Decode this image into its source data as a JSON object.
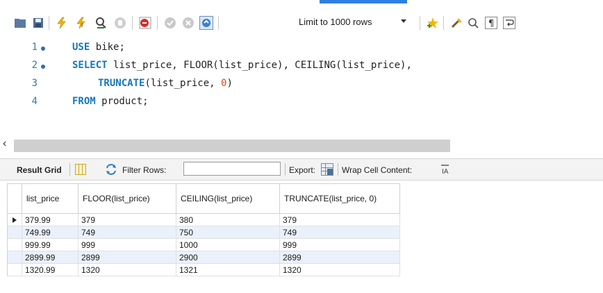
{
  "toolbar": {
    "limit_label": "Limit to 1000 rows"
  },
  "editor": {
    "lines": [
      {
        "num": "1",
        "has_dot": true
      },
      {
        "num": "2",
        "has_dot": true
      },
      {
        "num": "3",
        "has_dot": false
      },
      {
        "num": "4",
        "has_dot": false
      }
    ],
    "code": {
      "l1_kw": "USE",
      "l1_rest": " bike;",
      "l2_kw": "SELECT",
      "l2_rest": " list_price, FLOOR(list_price), CEILING(list_price),",
      "l3_fn": "TRUNCATE",
      "l3_a": "(list_price, ",
      "l3_num": "0",
      "l3_b": ")",
      "l4_kw": "FROM",
      "l4_rest": " product;"
    }
  },
  "results_toolbar": {
    "result_grid": "Result Grid",
    "filter_rows": "Filter Rows:",
    "filter_value": "",
    "export": "Export:",
    "wrap": "Wrap Cell Content:"
  },
  "grid": {
    "columns": [
      "list_price",
      "FLOOR(list_price)",
      "CEILING(list_price)",
      "TRUNCATE(list_price, 0)"
    ],
    "rows": [
      [
        "379.99",
        "379",
        "380",
        "379"
      ],
      [
        "749.99",
        "749",
        "750",
        "749"
      ],
      [
        "999.99",
        "999",
        "1000",
        "999"
      ],
      [
        "2899.99",
        "2899",
        "2900",
        "2899"
      ],
      [
        "1320.99",
        "1320",
        "1321",
        "1320"
      ]
    ]
  },
  "colors": {
    "keyword": "#1577b8",
    "number": "#d14d18",
    "selected_row_bg": "#eaf1fb"
  }
}
